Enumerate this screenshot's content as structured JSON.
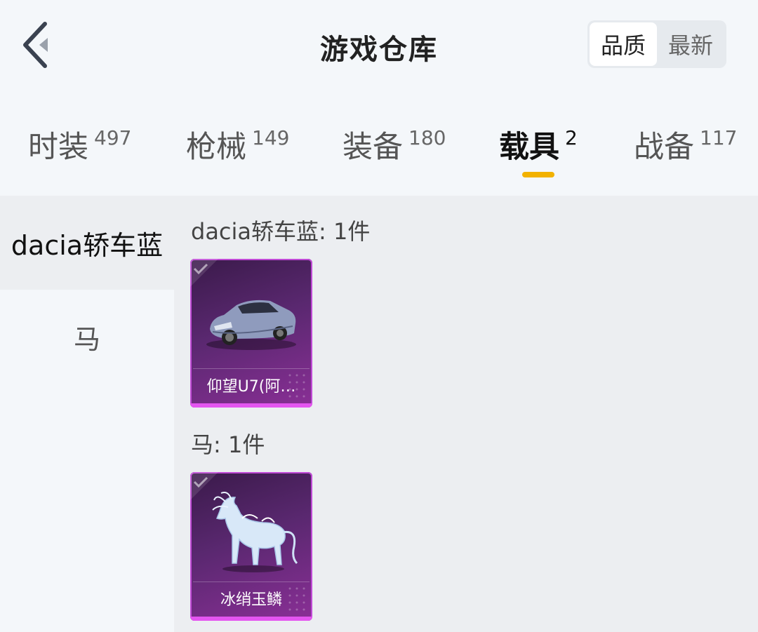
{
  "header": {
    "title": "游戏仓库",
    "sort_options": [
      {
        "label": "品质",
        "active": true
      },
      {
        "label": "最新",
        "active": false
      }
    ]
  },
  "tabs": [
    {
      "label": "时装",
      "count": "497",
      "active": false
    },
    {
      "label": "枪械",
      "count": "149",
      "active": false
    },
    {
      "label": "装备",
      "count": "180",
      "active": false
    },
    {
      "label": "载具",
      "count": "2",
      "active": true
    },
    {
      "label": "战备",
      "count": "117",
      "active": false
    }
  ],
  "sidebar": {
    "items": [
      {
        "label": "dacia轿车蓝",
        "active": true
      },
      {
        "label": "马",
        "active": false
      }
    ]
  },
  "groups": [
    {
      "title": "dacia轿车蓝: 1件",
      "items": [
        {
          "name": "仰望U7(阿…",
          "icon": "car-image"
        }
      ]
    },
    {
      "title": "马: 1件",
      "items": [
        {
          "name": "冰绡玉鳞",
          "icon": "ice-horse-image"
        }
      ]
    }
  ],
  "colors": {
    "accent_underline": "#f2b200",
    "card_rarity": "#c04ad6"
  }
}
